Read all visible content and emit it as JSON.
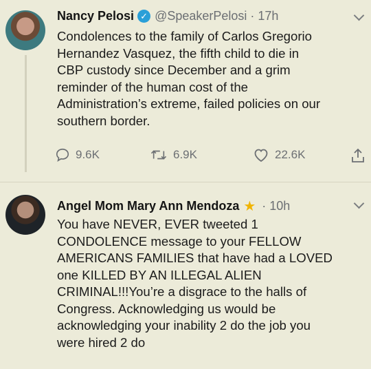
{
  "tweets": [
    {
      "name": "Nancy Pelosi",
      "handle": "@SpeakerPelosi",
      "time": "17h",
      "text": "Condolences to the family of Carlos Gregorio\nHernandez Vasquez, the fifth child to die in\nCBP custody since December and a grim\nreminder of the human cost of the\nAdministration’s extreme, failed policies on our\nsouthern border.",
      "replies": "9.6K",
      "retweets": "6.9K",
      "likes": "22.6K"
    },
    {
      "name": "Angel Mom Mary Ann Mendoza",
      "time": "10h",
      "text": "You have NEVER, EVER tweeted 1\nCONDOLENCE message to your FELLOW\nAMERICANS FAMILIES that have had a LOVED\none KILLED BY AN ILLEGAL ALIEN\nCRIMINAL!!!You’re a disgrace to the halls of\nCongress.  Acknowledging us would be\nacknowledging your inability 2 do the job you\nwere hired 2 do"
    }
  ],
  "colors": {
    "background": "#ecebd9",
    "verified": "#2a9fd8",
    "star": "#f0b400",
    "muted": "#6c6f73"
  },
  "icons": [
    "verified-badge-icon",
    "star-icon",
    "reply-icon",
    "retweet-icon",
    "like-icon",
    "share-icon",
    "chevron-down-icon"
  ]
}
